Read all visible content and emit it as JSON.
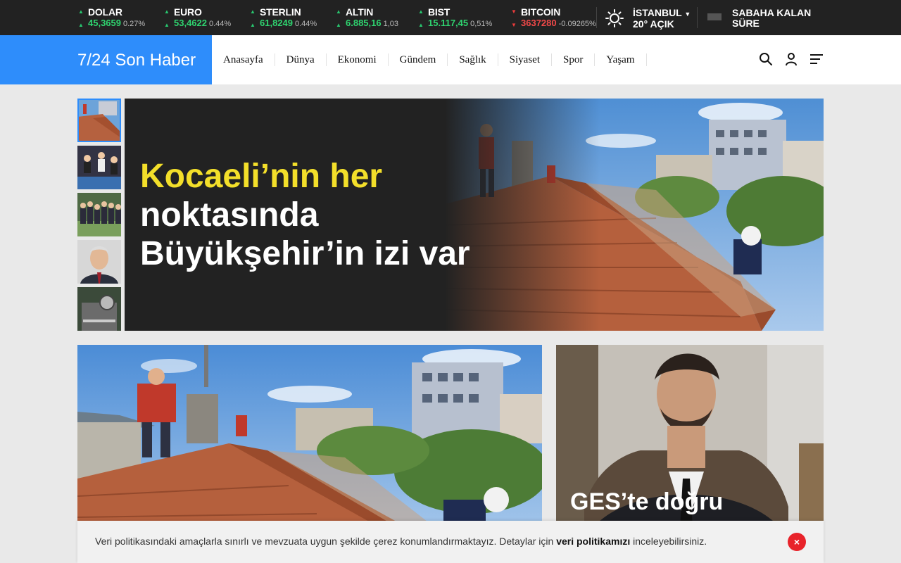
{
  "ticker": [
    {
      "name": "DOLAR",
      "value": "45,3659",
      "change": "0.27%",
      "dir": "up"
    },
    {
      "name": "EURO",
      "value": "53,4622",
      "change": "0.44%",
      "dir": "up"
    },
    {
      "name": "STERLIN",
      "value": "61,8249",
      "change": "0.44%",
      "dir": "up"
    },
    {
      "name": "ALTIN",
      "value": "6.885,16",
      "change": "1,03",
      "dir": "up"
    },
    {
      "name": "BIST",
      "value": "15.117,45",
      "change": "0,51%",
      "dir": "up"
    },
    {
      "name": "BITCOIN",
      "value": "3637280",
      "change": "-0.09265%",
      "dir": "down"
    }
  ],
  "weather": {
    "city": "İSTANBUL",
    "condition": "20° AÇIK",
    "icon": "sun-icon"
  },
  "countdown": {
    "line1": "SABAHA KALAN",
    "line2": "SÜRE"
  },
  "header": {
    "logo": "7/24 Son Haber",
    "nav": [
      "Anasayfa",
      "Dünya",
      "Ekonomi",
      "Gündem",
      "Sağlık",
      "Siyaset",
      "Spor",
      "Yaşam"
    ],
    "icons": [
      "search-icon",
      "user-icon",
      "menu-icon"
    ]
  },
  "hero": {
    "title_highlight": "Kocaeli’nin her",
    "title_rest_1": "noktasında",
    "title_rest_2": "Büyükşehir’in izi var"
  },
  "cards": {
    "second_title": "GES’te doğru"
  },
  "cookie": {
    "text_before": "Veri politikasındaki amaçlarla sınırlı ve mevzuata uygun şekilde çerez konumlandırmaktayız. Detaylar için ",
    "link": "veri politikamızı",
    "text_after": " inceleyebilirsiniz.",
    "close": "×"
  },
  "colors": {
    "accent": "#2e8dfb",
    "highlight": "#f3df2a",
    "up": "#2fd36f",
    "down": "#f04848",
    "dark": "#222222"
  }
}
